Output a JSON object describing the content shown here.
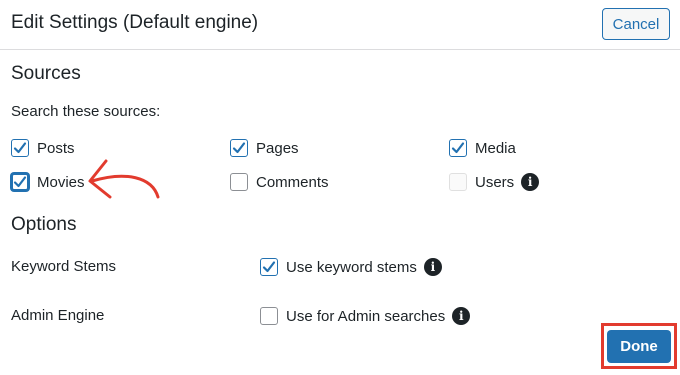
{
  "dialog": {
    "title": "Edit Settings (Default engine)",
    "cancel_label": "Cancel",
    "done_label": "Done"
  },
  "sources": {
    "heading": "Sources",
    "subtitle": "Search these sources:",
    "items": [
      {
        "label": "Posts",
        "checked": true
      },
      {
        "label": "Pages",
        "checked": true
      },
      {
        "label": "Media",
        "checked": true
      },
      {
        "label": "Movies",
        "checked": true
      },
      {
        "label": "Comments",
        "checked": false
      },
      {
        "label": "Users",
        "checked": false,
        "disabled": true
      }
    ]
  },
  "options": {
    "heading": "Options",
    "keyword_stems": {
      "label": "Keyword Stems",
      "checkbox_label": "Use keyword stems",
      "checked": true
    },
    "admin_engine": {
      "label": "Admin Engine",
      "checkbox_label": "Use for Admin searches",
      "checked": false
    }
  },
  "colors": {
    "accent": "#2271b1",
    "highlight": "#e23b2e",
    "text": "#1d2327"
  },
  "icons": [
    "checkmark-icon",
    "info-icon",
    "red-arrow-annotation-icon"
  ]
}
